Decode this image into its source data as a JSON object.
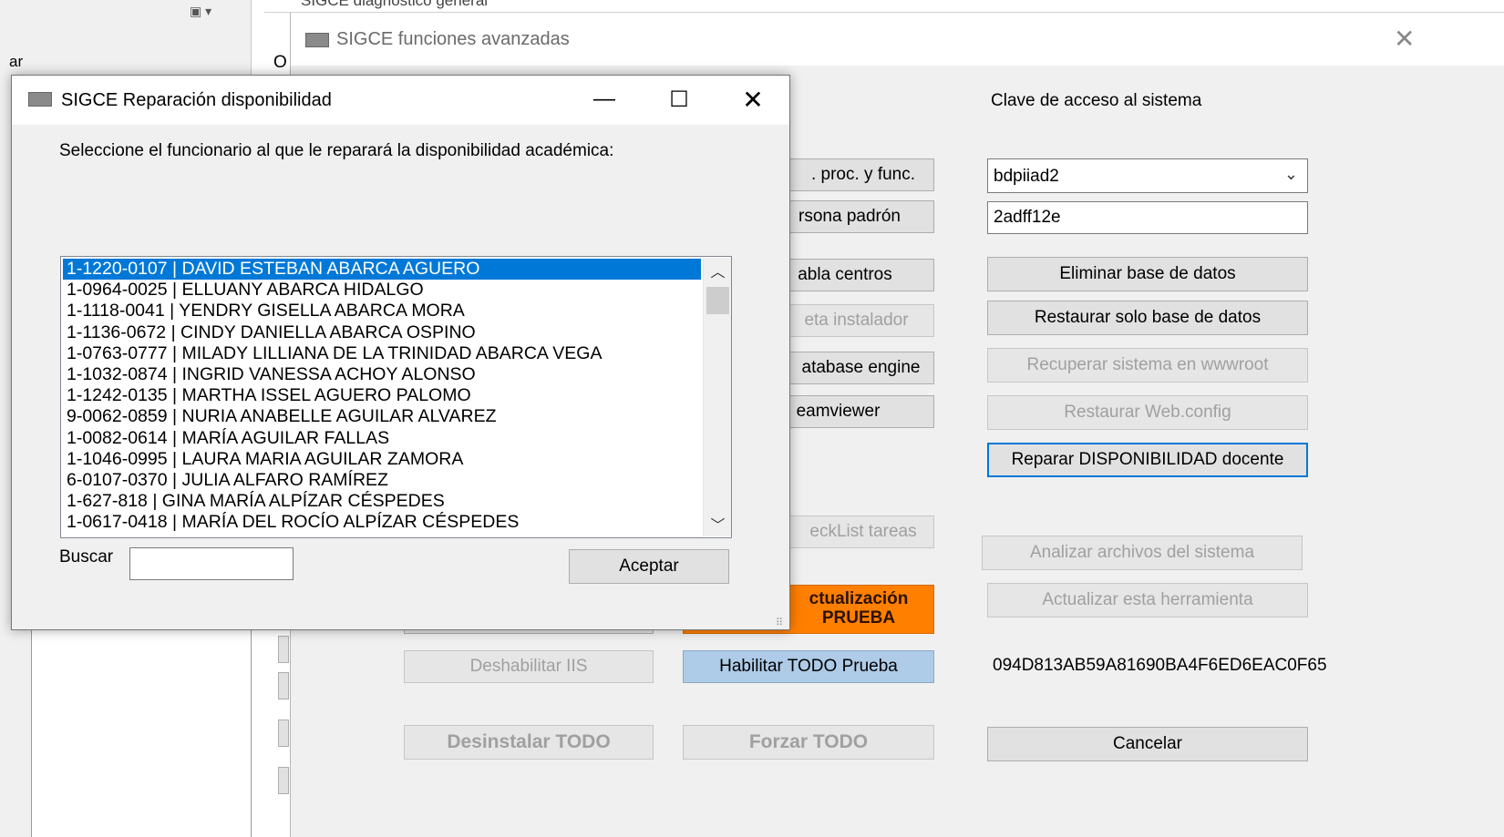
{
  "background_app": {
    "left_text": "ar",
    "left_tool": "▣ ▾",
    "diag_title": "SIGCE diagnostico general",
    "body_letter": "O"
  },
  "advanced_window": {
    "title": "SIGCE funciones avanzadas",
    "close_glyph": "✕",
    "key_label": "Clave de acceso al sistema",
    "db_select_value": "bdpiiad2",
    "key_value": "2adff12e",
    "hash": "094D813AB59A81690BA4F6ED6EAC0F65",
    "buttons": {
      "proc_func": ". proc. y func.",
      "persona_padron": "rsona padrón",
      "tabla_centros": "abla centros",
      "carpeta_instalador": "eta instalador",
      "database_engine": "atabase engine",
      "teamviewer": "eamviewer",
      "checklist": "eckList tareas",
      "actualizacion_1": "ctualización",
      "actualizacion_2": "PRUEBA",
      "habilitar_todo": "Habilitar TODO Prueba",
      "forzar_todo": "Forzar TODO",
      "deshabilitar_iis": "Deshabilitar IIS",
      "desinstalar_todo": "Desinstalar TODO",
      "eliminar_bd": "Eliminar base de datos",
      "restaurar_bd": "Restaurar solo base de datos",
      "recuperar_sistema": "Recuperar sistema en wwwroot",
      "restaurar_webconfig": "Restaurar Web.config",
      "reparar_disponibilidad": "Reparar DISPONIBILIDAD docente",
      "analizar_archivos": "Analizar archivos del sistema",
      "actualizar_herramienta": "Actualizar esta herramienta",
      "cancelar": "Cancelar"
    }
  },
  "dialog": {
    "title": "SIGCE Reparación disponibilidad",
    "minimize_glyph": "—",
    "maximize_glyph": "☐",
    "close_glyph": "✕",
    "prompt": "Seleccione el funcionario al que le reparará la disponibilidad académica:",
    "list_items": [
      "1-1220-0107 | DAVID ESTEBAN ABARCA AGUERO",
      "1-0964-0025 | ELLUANY ABARCA HIDALGO",
      "1-1118-0041 | YENDRY GISELLA ABARCA MORA",
      "1-1136-0672 | CINDY DANIELLA ABARCA OSPINO",
      "1-0763-0777 | MILADY LILLIANA DE LA TRINIDAD ABARCA VEGA",
      "1-1032-0874 | INGRID VANESSA ACHOY ALONSO",
      "1-1242-0135 | MARTHA ISSEL AGUERO PALOMO",
      "9-0062-0859 | NURIA ANABELLE AGUILAR ALVAREZ",
      "1-0082-0614 | MARÍA AGUILAR FALLAS",
      "1-1046-0995 | LAURA MARIA AGUILAR ZAMORA",
      "6-0107-0370 | JULIA ALFARO RAMÍREZ",
      "1-627-818 | GINA MARÍA ALPÍZAR CÉSPEDES",
      "1-0617-0418 | MARÍA DEL ROCÍO ALPÍZAR CÉSPEDES"
    ],
    "selected_index": 0,
    "scroll_up_glyph": "︿",
    "scroll_down_glyph": "﹀",
    "search_label": "Buscar",
    "search_value": "",
    "accept_label": "Aceptar"
  }
}
